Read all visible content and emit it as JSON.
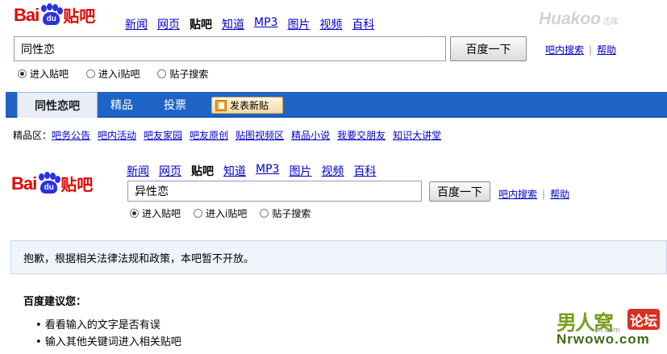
{
  "top": {
    "logo_bai": "Bai",
    "logo_du": "du",
    "logo_tieba": "贴吧",
    "nav": [
      "新闻",
      "网页",
      "贴吧",
      "知道",
      "MP3",
      "图片",
      "视频",
      "百科"
    ],
    "nav_current": "贴吧",
    "search_value": "同性恋",
    "search_button": "百度一下",
    "link_inbar": "吧内搜索",
    "link_help": "帮助",
    "sep": "|",
    "radios": [
      "进入贴吧",
      "进入i贴吧",
      "贴子搜索"
    ],
    "radio_selected": 0
  },
  "watermark_top": {
    "brand": "Huakoo",
    "suffix": "活库"
  },
  "tabs": {
    "active": "同性恋吧",
    "items": [
      "精品",
      "投票"
    ],
    "post_button": "发表新贴"
  },
  "jingpin": {
    "label": "精品区：",
    "items": [
      "吧务公告",
      "吧内活动",
      "吧友家园",
      "吧友原创",
      "贴图视频区",
      "精品小说",
      "我要交朋友",
      "知识大讲堂"
    ]
  },
  "second": {
    "logo_bai": "Bai",
    "logo_du": "du",
    "logo_tieba": "贴吧",
    "nav": [
      "新闻",
      "网页",
      "贴吧",
      "知道",
      "MP3",
      "图片",
      "视频",
      "百科"
    ],
    "nav_current": "贴吧",
    "search_value": "异性恋",
    "search_button": "百度一下",
    "link_inbar": "吧内搜索",
    "link_help": "帮助",
    "sep": "|",
    "radios": [
      "进入贴吧",
      "进入i贴吧",
      "贴子搜索"
    ],
    "radio_selected": 0
  },
  "notice": "抱歉，根据相关法律法规和政策，本吧暂不开放。",
  "suggest": {
    "title": "百度建议您：",
    "items": [
      "• 看看输入的文字是否有误",
      "• 输入其他关键词进入相关贴吧"
    ]
  },
  "watermark_bottom": {
    "cn": "男人窝",
    "badge": "论坛",
    "url": "Nrwowo.com",
    "small": "m.com"
  },
  "colors": {
    "brand_red": "#e10602",
    "brand_blue": "#2932e1",
    "tab_blue": "#1f64c4",
    "link": "#0000cc"
  }
}
